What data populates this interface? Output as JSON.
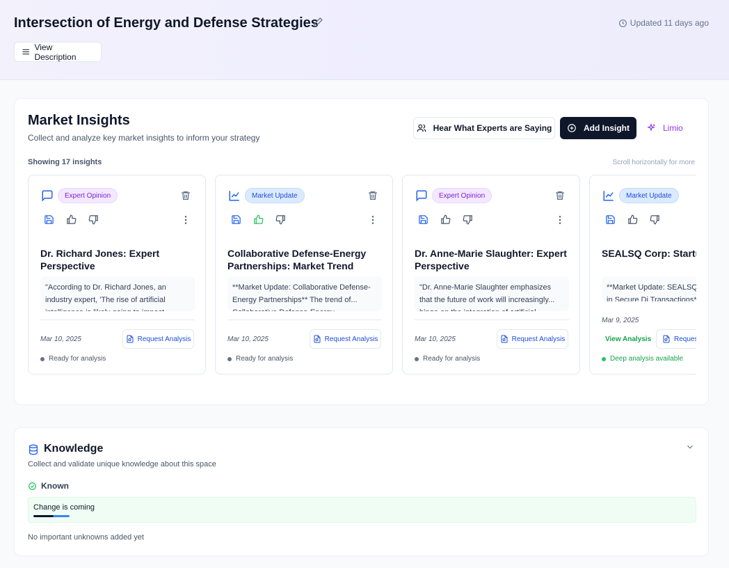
{
  "header": {
    "title": "Intersection of Energy and Defense Strategies",
    "updated": "Updated 11 days ago",
    "view_description": "View Description"
  },
  "market_insights": {
    "title": "Market Insights",
    "subtitle": "Collect and analyze key market insights to inform your strategy",
    "experts_button": "Hear What Experts are Saying",
    "add_button": "Add Insight",
    "limio_button": "Limio",
    "showing": "Showing 17 insights",
    "scroll_hint": "Scroll horizontally for more",
    "cards": [
      {
        "badge": "Expert Opinion",
        "title": "Dr. Richard Jones: Expert Perspective",
        "excerpt": "\"According to Dr. Richard Jones, an industry expert, 'The rise of artificial intelligence is likely going to impact...",
        "date": "Mar 10, 2025",
        "request": "Request Analysis",
        "status": "Ready for analysis",
        "liked": false
      },
      {
        "badge": "Market Update",
        "title": "Collaborative Defense-Energy Partnerships: Market Trend",
        "excerpt": "**Market Update: Collaborative Defense-Energy Partnerships** The trend of... Collaborative Defense-Energy...",
        "date": "Mar 10, 2025",
        "request": "Request Analysis",
        "status": "Ready for analysis",
        "liked": true
      },
      {
        "badge": "Expert Opinion",
        "title": "Dr. Anne-Marie Slaughter: Expert Perspective",
        "excerpt": "\"Dr. Anne-Marie Slaughter emphasizes that the future of work will increasingly... hinge on the integration of artificial...",
        "date": "Mar 10, 2025",
        "request": "Request Analysis",
        "status": "Ready for analysis",
        "liked": false
      },
      {
        "badge": "Market Update",
        "title": "SEALSQ Corp: Startup",
        "excerpt": "**Market Update: SEALSQ as a Disruptor in Secure Di Transactions** SEALSQ C...",
        "date": "Mar 9, 2025",
        "view_analysis": "View Analysis",
        "request": "Request",
        "status": "Deep analysis available",
        "liked": false
      }
    ]
  },
  "knowledge": {
    "title": "Knowledge",
    "subtitle": "Collect and validate unique knowledge about this space",
    "known_label": "Known",
    "known_item": "Change is coming",
    "unknowns": "No important unknowns added yet"
  },
  "colors": {
    "primary": "#0f172a",
    "expert_badge": "#7e22ce",
    "market_badge": "#1d4ed8",
    "success": "#16a34a",
    "limio": "#9333ea"
  }
}
